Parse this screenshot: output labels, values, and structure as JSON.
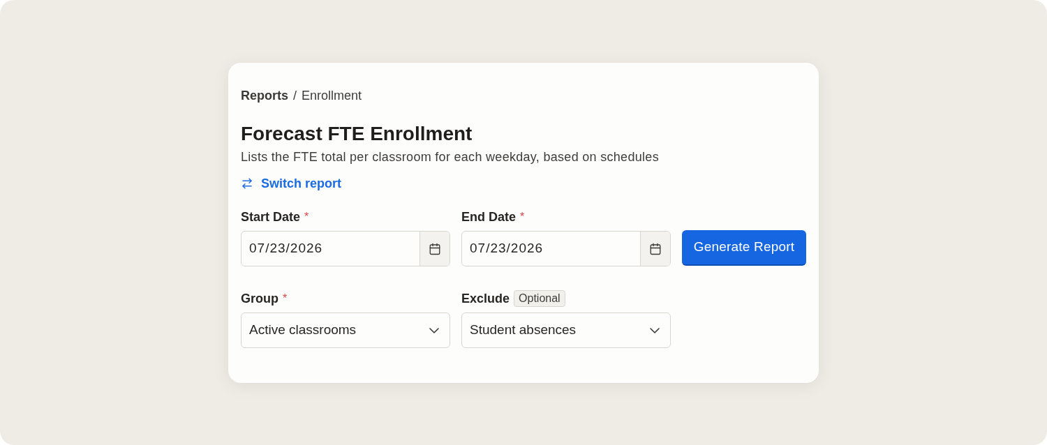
{
  "breadcrumb": {
    "items": [
      "Reports",
      "Enrollment"
    ],
    "separator": "/"
  },
  "title": "Forecast FTE Enrollment",
  "subtitle": "Lists the FTE total per classroom for each weekday, based on schedules",
  "switch_link": {
    "label": "Switch report"
  },
  "fields": [
    {
      "kind": "date",
      "label": "Start Date",
      "required_mark": "*",
      "value": "07/23/2026"
    },
    {
      "kind": "date",
      "label": "End Date",
      "required_mark": "*",
      "value": "07/23/2026"
    },
    {
      "kind": "select",
      "label": "Group",
      "required_mark": "*",
      "value": "Active classrooms"
    },
    {
      "kind": "select",
      "label": "Exclude",
      "badge": "Optional",
      "value": "Student absences"
    }
  ],
  "generate_button": {
    "label": "Generate Report"
  }
}
